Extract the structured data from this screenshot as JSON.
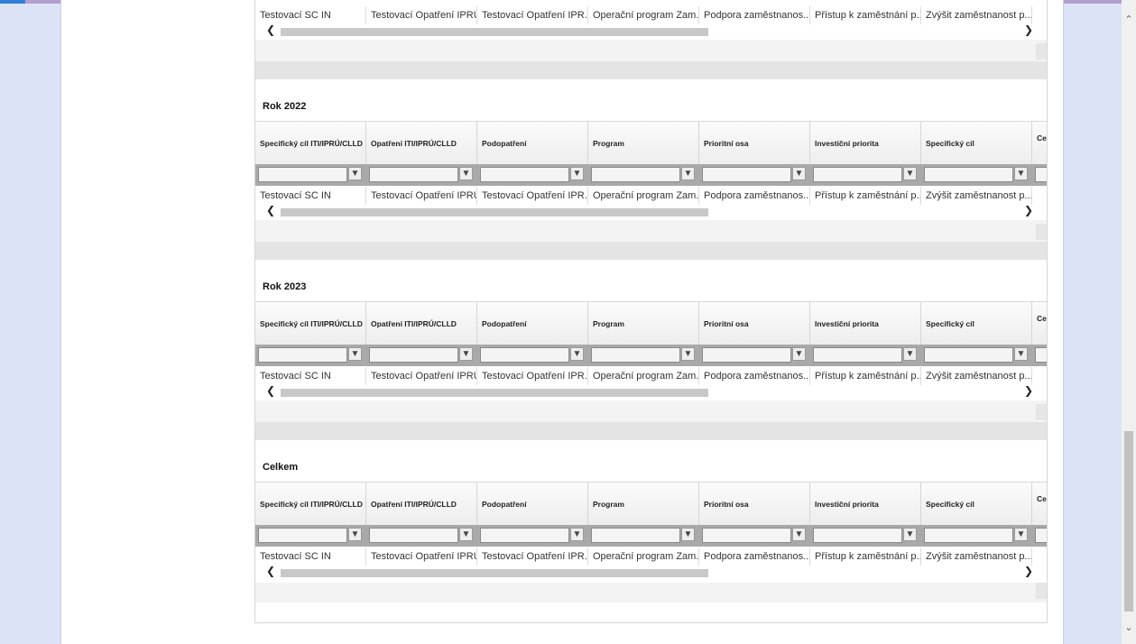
{
  "columns": [
    "Specifický cíl ITI/IPRÚ/CLLD",
    "Opatření ITI/IPRÚ/CLLD",
    "Podopatření",
    "Program",
    "Prioritní osa",
    "Investiční priorita",
    "Specifický cíl",
    "Ce vý"
  ],
  "row": [
    "Testovací SC IN",
    "Testovací Opatření IPRÚ",
    "Testovací Opatření IPR...",
    "Operační program Zam...",
    "Podpora zaměstnanos...",
    "Přístup k zaměstnání p...",
    "Zvýšit zaměstnanost p...",
    ""
  ],
  "sections": [
    {
      "title": "Rok 2022"
    },
    {
      "title": "Rok 2023"
    },
    {
      "title": "Celkem"
    }
  ],
  "icons": {
    "filter": "filter-icon",
    "scroll_left": "chevron-left-icon",
    "scroll_right": "chevron-right-icon"
  }
}
